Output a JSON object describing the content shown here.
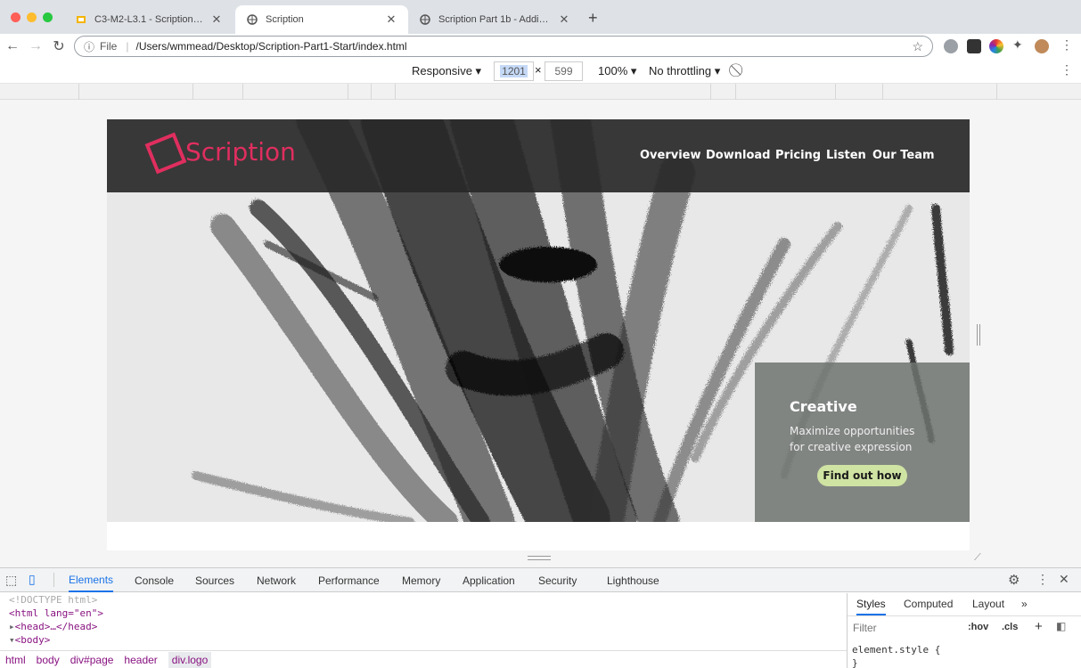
{
  "browser": {
    "tabs": [
      {
        "title": "C3-M2-L3.1 - Scription Site - /"
      },
      {
        "title": "Scription"
      },
      {
        "title": "Scription Part 1b - Adding CSS"
      }
    ],
    "new_tab": "+",
    "url_scheme": "File",
    "url": "/Users/wmmead/Desktop/Scription-Part1-Start/index.html"
  },
  "device_toolbar": {
    "mode": "Responsive",
    "width": "1201",
    "times": "×",
    "height": "599",
    "zoom": "100%",
    "throttling": "No throttling"
  },
  "site": {
    "logo": "Scription",
    "nav": [
      "Overview",
      "Download",
      "Pricing",
      "Listen",
      "Our Team"
    ],
    "promo": {
      "heading": "Creative",
      "text": "Maximize opportunities for creative expression",
      "button": "Find out how"
    },
    "colors": {
      "logo": "#e02e5f",
      "button": "#cfe3a3"
    }
  },
  "devtools": {
    "tabs": [
      "Elements",
      "Console",
      "Sources",
      "Network",
      "Performance",
      "Memory",
      "Application",
      "Security",
      "Lighthouse"
    ],
    "dom": {
      "doctype": "<!DOCTYPE html>",
      "html_open": "<html lang=\"en\">",
      "head": "<head>…</head>",
      "body": "<body>"
    },
    "breadcrumbs": [
      "html",
      "body",
      "div#page",
      "header",
      "div.logo"
    ],
    "side_tabs": [
      "Styles",
      "Computed",
      "Layout"
    ],
    "more": "»",
    "filter_placeholder": "Filter",
    "hov": ":hov",
    "cls": ".cls",
    "element_style": "element.style {",
    "close_brace": "}"
  }
}
